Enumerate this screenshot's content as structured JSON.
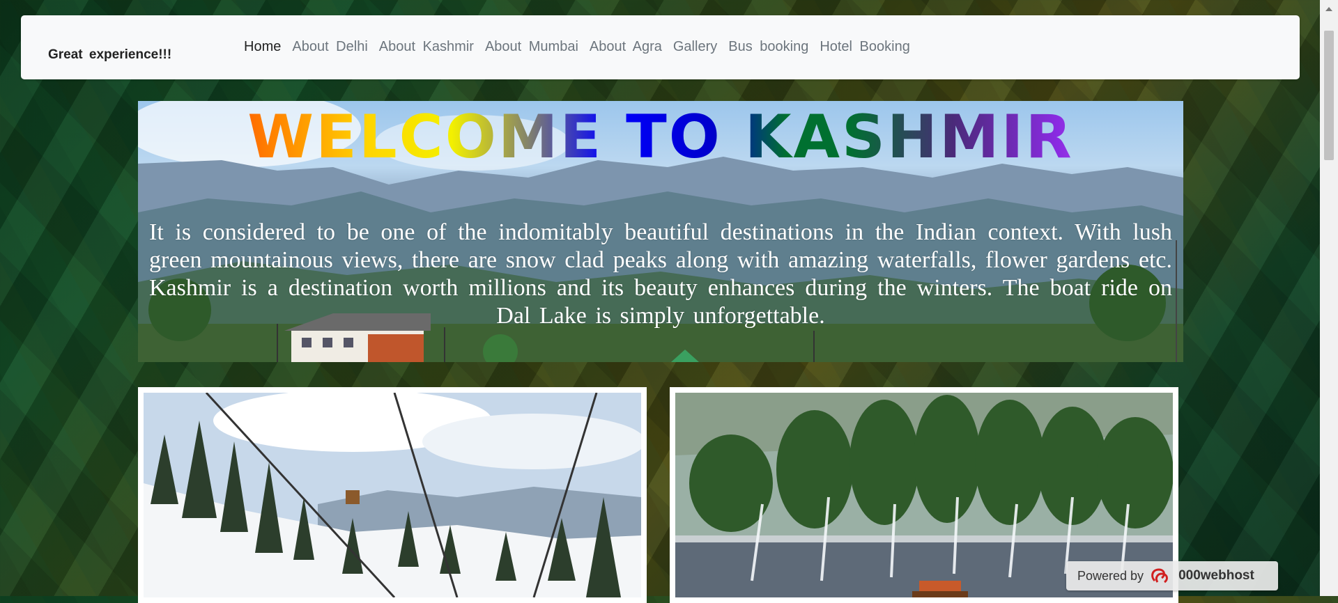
{
  "navbar": {
    "brand": "Great experience!!!",
    "links": [
      {
        "label": "Home",
        "active": true
      },
      {
        "label": "About Delhi"
      },
      {
        "label": "About Kashmir"
      },
      {
        "label": "About Mumbai"
      },
      {
        "label": "About Agra"
      },
      {
        "label": "Gallery"
      },
      {
        "label": "Bus booking"
      },
      {
        "label": "Hotel Booking"
      }
    ]
  },
  "hero": {
    "title": "WELCOME TO KASHMIR",
    "text": "It is considered to be one of the indomitably beautiful destinations in the Indian context. With lush green mountainous views, there are snow clad peaks along with amazing waterfalls, flower gardens etc. Kashmir is a destination worth millions and its beauty enhances during the winters. The boat ride on Dal Lake is simply unforgettable."
  },
  "badge": {
    "prefix": "Powered by",
    "brand": "000webhost"
  },
  "colors": {
    "navbar_bg": "#f8f9fa",
    "active_link": "#222222",
    "inactive_link": "#6c757d"
  }
}
